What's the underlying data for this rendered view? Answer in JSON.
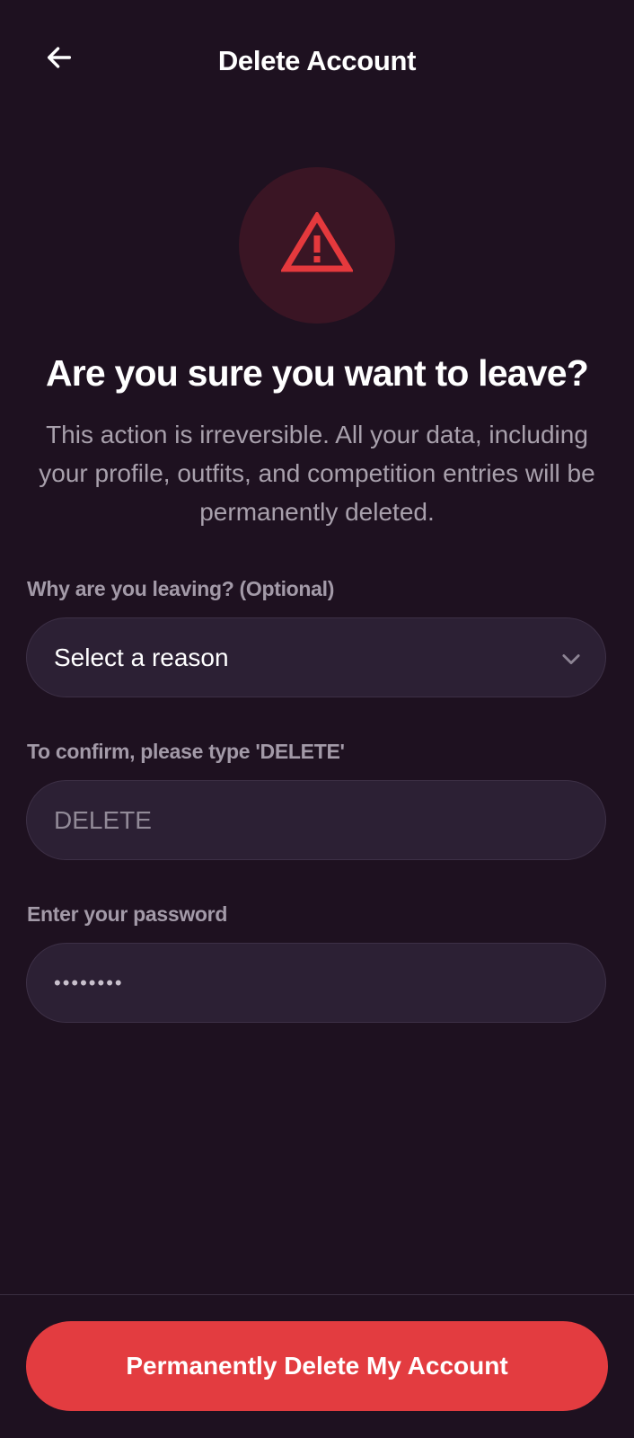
{
  "header": {
    "title": "Delete Account",
    "back_icon": "arrow-left-icon"
  },
  "warning": {
    "icon": "warning-triangle-icon",
    "icon_color": "#e5393d",
    "circle_color": "#3a1524"
  },
  "heading": "Are you sure you want to leave?",
  "description": "This action is irreversible. All your data, including your profile, outfits, and competition entries will be permanently deleted.",
  "reason_field": {
    "label": "Why are you leaving? (Optional)",
    "selected_value": "Select a reason",
    "icon": "chevron-down-icon"
  },
  "confirm_field": {
    "label": "To confirm, please type 'DELETE'",
    "placeholder": "DELETE",
    "value": ""
  },
  "password_field": {
    "label": "Enter your password",
    "masked_value": "••••••••"
  },
  "footer": {
    "button_label": "Permanently Delete My Account",
    "button_color": "#e33c40"
  },
  "colors": {
    "background": "#1e1120",
    "field_background": "#2c2034",
    "label_text": "#a39aa8"
  }
}
